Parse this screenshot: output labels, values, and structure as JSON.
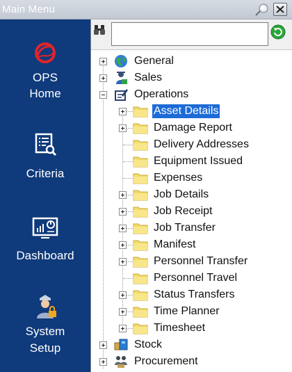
{
  "window": {
    "title": "Main Menu"
  },
  "nav": [
    {
      "key": "ops_home",
      "label_lines": [
        "OPS",
        "Home"
      ],
      "icon": "ops-logo-icon"
    },
    {
      "key": "criteria",
      "label_lines": [
        "Criteria"
      ],
      "icon": "criteria-icon"
    },
    {
      "key": "dashboard",
      "label_lines": [
        "Dashboard"
      ],
      "icon": "dashboard-icon"
    },
    {
      "key": "system_setup",
      "label_lines": [
        "System",
        "Setup"
      ],
      "icon": "system-setup-icon"
    }
  ],
  "search": {
    "value": "",
    "placeholder": ""
  },
  "tree": {
    "top": [
      {
        "label": "General",
        "icon": "globe-icon",
        "expanded": false
      },
      {
        "label": "Sales",
        "icon": "sales-person-icon",
        "expanded": false
      },
      {
        "label": "Operations",
        "icon": "operations-icon",
        "expanded": true
      },
      {
        "label": "Stock",
        "icon": "stock-icon",
        "expanded": false
      },
      {
        "label": "Procurement",
        "icon": "procurement-icon",
        "expanded": false
      }
    ],
    "operations_children": [
      {
        "label": "Asset Details",
        "expandable": true,
        "selected": true
      },
      {
        "label": "Damage Report",
        "expandable": true,
        "selected": false
      },
      {
        "label": "Delivery Addresses",
        "expandable": false,
        "selected": false
      },
      {
        "label": "Equipment Issued",
        "expandable": false,
        "selected": false
      },
      {
        "label": "Expenses",
        "expandable": false,
        "selected": false
      },
      {
        "label": "Job Details",
        "expandable": true,
        "selected": false
      },
      {
        "label": "Job Receipt",
        "expandable": true,
        "selected": false
      },
      {
        "label": "Job Transfer",
        "expandable": true,
        "selected": false
      },
      {
        "label": "Manifest",
        "expandable": true,
        "selected": false
      },
      {
        "label": "Personnel Transfer",
        "expandable": true,
        "selected": false
      },
      {
        "label": "Personnel Travel",
        "expandable": false,
        "selected": false
      },
      {
        "label": "Status Transfers",
        "expandable": true,
        "selected": false
      },
      {
        "label": "Time Planner",
        "expandable": true,
        "selected": false
      },
      {
        "label": "Timesheet",
        "expandable": true,
        "selected": false
      }
    ]
  },
  "colors": {
    "nav_bg": "#0f3a7b",
    "selection": "#1d6bd6",
    "folder": "#f4dc6a",
    "ops_logo": "#e0242b"
  }
}
